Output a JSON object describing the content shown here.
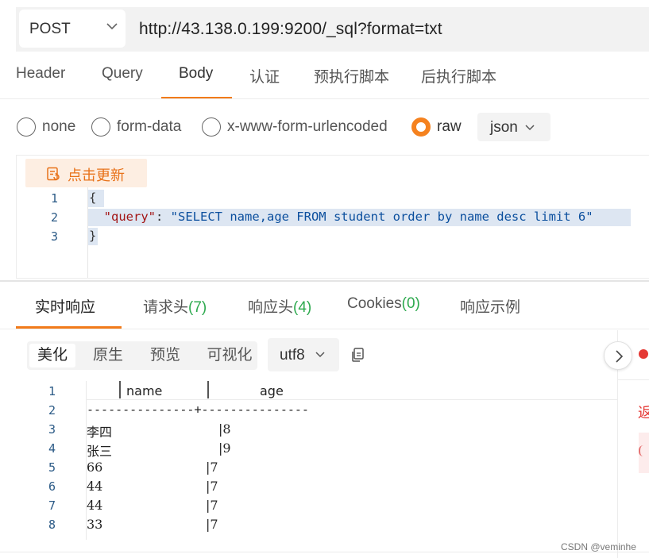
{
  "request": {
    "method": "POST",
    "url": "http://43.138.0.199:9200/_sql?format=txt"
  },
  "request_tabs": [
    {
      "label": "Header"
    },
    {
      "label": "Query"
    },
    {
      "label": "Body",
      "active": true
    },
    {
      "label": "认证"
    },
    {
      "label": "预执行脚本"
    },
    {
      "label": "后执行脚本"
    }
  ],
  "body_types": {
    "none": "none",
    "form_data": "form-data",
    "urlencoded": "x-www-form-urlencoded",
    "raw": "raw",
    "selected": "raw",
    "format": "json"
  },
  "editor": {
    "refresh_label": "点击更新",
    "line_numbers": [
      "1",
      "2",
      "3"
    ],
    "line1": "{",
    "line2_key": "\"query\"",
    "line2_colon": ": ",
    "line2_value": "\"SELECT name,age FROM student order by name desc limit 6\"",
    "line3": "}"
  },
  "response_tabs": [
    {
      "label": "实时响应",
      "active": true
    },
    {
      "label": "请求头",
      "count": "(7)"
    },
    {
      "label": "响应头",
      "count": "(4)"
    },
    {
      "label": "Cookies",
      "count": "(0)"
    },
    {
      "label": "响应示例"
    }
  ],
  "view_modes": {
    "pretty": "美化",
    "raw": "原生",
    "preview": "预览",
    "visualize": "可视化",
    "selected": "美化"
  },
  "encoding": "utf8",
  "response": {
    "line_numbers": [
      "1",
      "2",
      "3",
      "4",
      "5",
      "6",
      "7",
      "8"
    ],
    "header_name": "name",
    "header_age": "age",
    "separator": "---------------+---------------",
    "rows": [
      {
        "name": "李四",
        "age": "|8"
      },
      {
        "name": "张三",
        "age": "|9"
      },
      {
        "name": "66",
        "age": "|7"
      },
      {
        "name": "44",
        "age": "|7"
      },
      {
        "name": "44",
        "age": "|7"
      },
      {
        "name": "33",
        "age": "|7"
      }
    ]
  },
  "side_panel": {
    "label": "返"
  },
  "watermark": "CSDN @veminhe",
  "colors": {
    "accent": "#f27b1a",
    "count_green": "#2eaa4f",
    "error_red": "#e53935"
  }
}
